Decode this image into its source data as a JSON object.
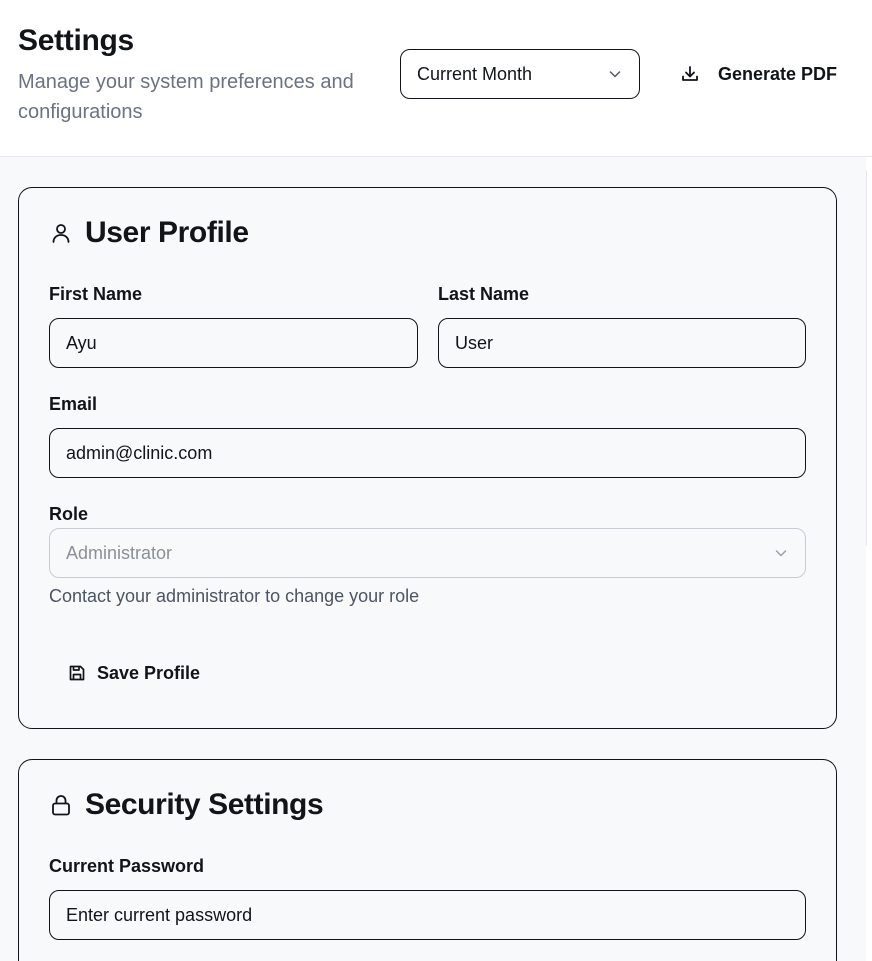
{
  "header": {
    "title": "Settings",
    "subtitle": "Manage your system preferences and configurations",
    "period_select": {
      "value": "Current Month"
    },
    "generate_pdf_label": "Generate PDF"
  },
  "user_profile": {
    "title": "User Profile",
    "icon": "user-icon",
    "first_name": {
      "label": "First Name",
      "value": "Ayu"
    },
    "last_name": {
      "label": "Last Name",
      "value": "User"
    },
    "email": {
      "label": "Email",
      "value": "admin@clinic.com"
    },
    "role": {
      "label": "Role",
      "value": "Administrator",
      "help": "Contact your administrator to change your role"
    },
    "save_label": "Save Profile"
  },
  "security": {
    "title": "Security Settings",
    "icon": "lock-icon",
    "current_password": {
      "label": "Current Password",
      "placeholder": "Enter current password"
    }
  }
}
